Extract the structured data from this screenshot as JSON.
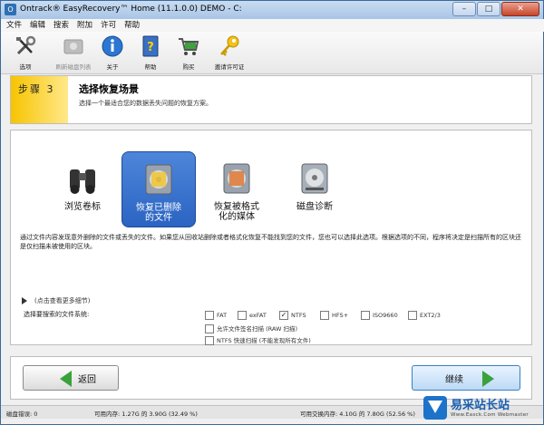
{
  "window": {
    "title": "Ontrack® EasyRecovery™ Home (11.1.0.0) DEMO - C:",
    "minimize": "–",
    "maximize": "□",
    "close": "✕"
  },
  "menu": [
    "文件",
    "编辑",
    "搜索",
    "附加",
    "许可",
    "帮助"
  ],
  "toolbar": [
    {
      "label": "选项",
      "icon": "tools-icon",
      "disabled": false
    },
    {
      "label": "刷新磁盘列表",
      "icon": "refresh-disk-icon",
      "disabled": true
    },
    {
      "label": "关于",
      "icon": "info-icon",
      "disabled": false
    },
    {
      "label": "帮助",
      "icon": "help-book-icon",
      "disabled": false
    },
    {
      "label": "购买",
      "icon": "cart-icon",
      "disabled": false
    },
    {
      "label": "邀请许可证",
      "icon": "key-icon",
      "disabled": false
    }
  ],
  "step": {
    "badge": "步骤 3",
    "title": "选择恢复场景",
    "subtitle": "选择一个最适合您的数据丢失问题的恢复方案。"
  },
  "scenarios": [
    {
      "label": "浏览卷标",
      "icon": "binoculars-icon",
      "selected": false
    },
    {
      "label": "恢复已删除\n的文件",
      "icon": "recover-deleted-icon",
      "selected": true
    },
    {
      "label": "恢复被格式\n化的媒体",
      "icon": "formatted-media-icon",
      "selected": false
    },
    {
      "label": "磁盘诊断",
      "icon": "disk-diagnostic-icon",
      "selected": false
    }
  ],
  "description": "通过文件内容发现意外删除的文件或丢失的文件。如果您从回收站删除或者格式化恢复不能找到您的文件，您也可以选择此选项。根据选项的不同，程序将决定是扫描所有的区块还是仅扫描未被使用的区块。",
  "more_details": "(点击查看更多细节)",
  "fs_label": "选择要搜索的文件系统:",
  "filesystems": [
    {
      "label": "FAT",
      "checked": false
    },
    {
      "label": "exFAT",
      "checked": false
    },
    {
      "label": "NTFS",
      "checked": true
    },
    {
      "label": "HFS+",
      "checked": false
    },
    {
      "label": "ISO9660",
      "checked": false
    },
    {
      "label": "EXT2/3",
      "checked": false
    }
  ],
  "options": [
    {
      "label": "允许文件签名扫描 (RAW 扫描)",
      "checked": false
    },
    {
      "label": "NTFS 快速扫描 (不能发现所有文件)",
      "checked": false
    }
  ],
  "nav": {
    "back": "返回",
    "next": "继续"
  },
  "status": {
    "errors": "磁盘错误: 0",
    "memory": "可用内存: 1.27G 的 3.90G (32.49 %)",
    "swap": "可用交换内存: 4.10G 的 7.80G (52.56 %)"
  },
  "watermark": {
    "text": "易采站长站",
    "sub": "Www.Easck.Com Webmaster"
  }
}
